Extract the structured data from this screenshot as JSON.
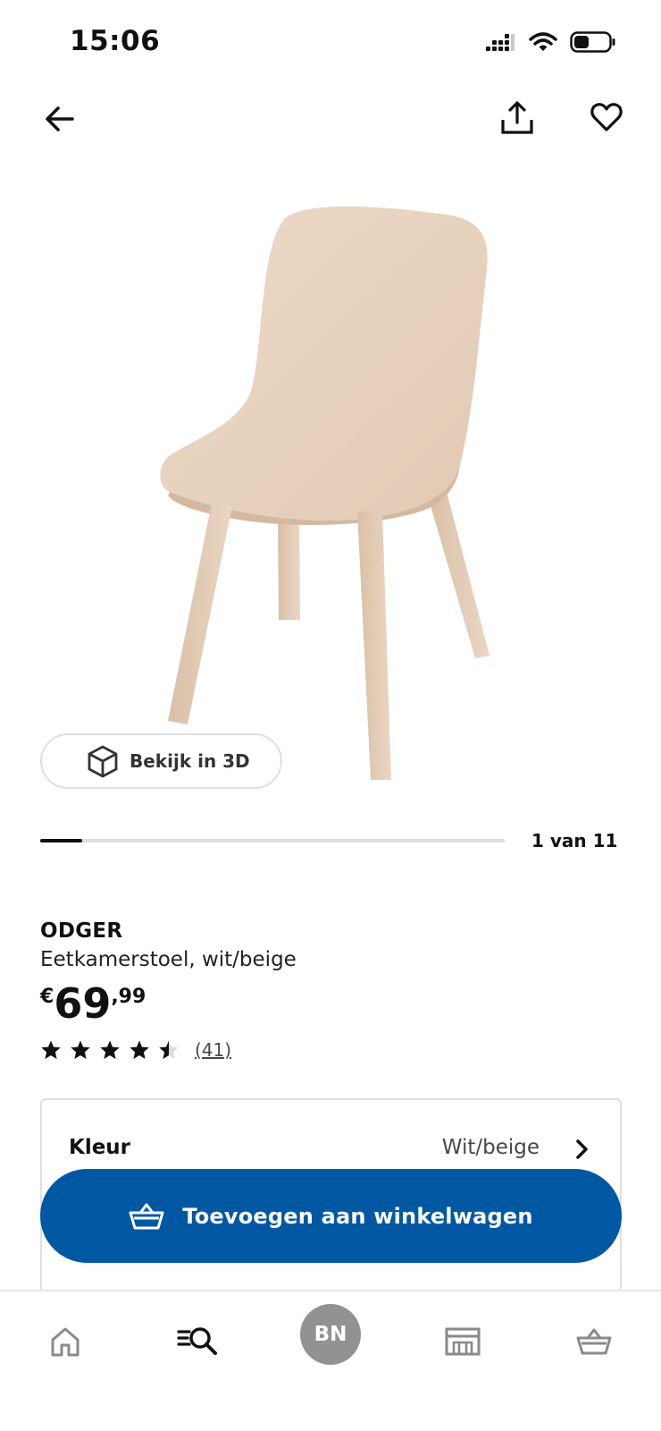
{
  "status_bar": {
    "time": "15:06"
  },
  "top_nav": {
    "back_icon": "arrow-left-icon",
    "share_icon": "share-icon",
    "favorite_icon": "heart-icon"
  },
  "gallery": {
    "view3d_label": "Bekijk in 3D",
    "counter": "1 van 11",
    "progress_fraction": 0.0909
  },
  "product": {
    "name": "ODGER",
    "description": "Eetkamerstoel, wit/beige",
    "price": {
      "currency": "€",
      "integer": "69",
      "decimal": ",99"
    },
    "rating": {
      "value": 4.5,
      "max": 5,
      "review_count": "(41)"
    }
  },
  "options": {
    "color_label": "Kleur",
    "color_value": "Wit/beige"
  },
  "cta": {
    "label": "Toevoegen aan winkelwagen"
  },
  "bottom_nav": {
    "avatar_initials": "BN",
    "items": [
      "home-icon",
      "search-icon",
      "avatar",
      "store-icon",
      "basket-icon"
    ]
  },
  "colors": {
    "primary_blue": "#0058a3",
    "chair_beige": "#e8d2bd",
    "avatar_gray": "#929292"
  }
}
